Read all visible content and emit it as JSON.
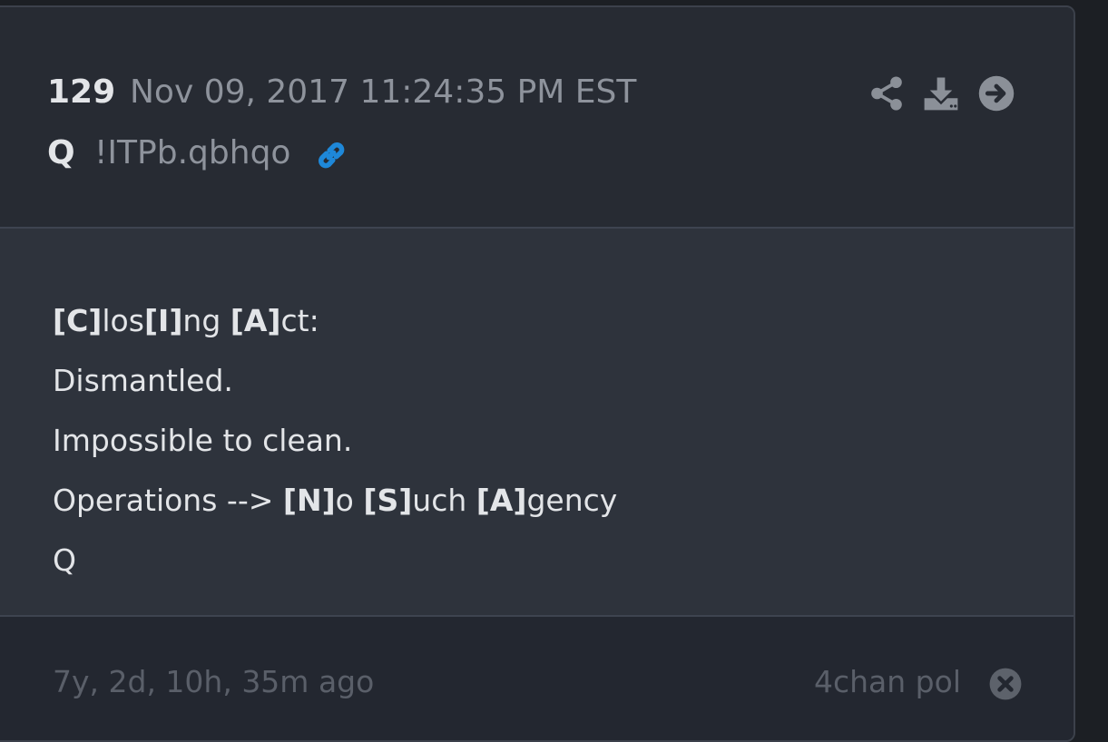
{
  "post": {
    "number": "129",
    "date": "Nov 09, 2017 11:24:35 PM EST",
    "author": "Q",
    "tripcode": "!ITPb.qbhqo"
  },
  "content": {
    "line1": {
      "a": "[C]",
      "b": "los",
      "c": "[I]",
      "d": "ng ",
      "e": "[A]",
      "f": "ct:"
    },
    "line2": "Dismantled.",
    "line3": "Impossible to clean.",
    "line4": {
      "a": "Operations --> ",
      "b": "[N]",
      "c": "o ",
      "d": "[S]",
      "e": "uch ",
      "f": "[A]",
      "g": "gency"
    },
    "line5": "Q"
  },
  "footer": {
    "ago": "7y, 2d, 10h, 35m ago",
    "source": "4chan pol"
  },
  "icons": {
    "link": "link-icon",
    "share": "share-icon",
    "download": "download-icon",
    "open": "arrow-right-circle-icon",
    "close": "close-circle-icon"
  },
  "colors": {
    "background": "#1c1f24",
    "card": "#272b33",
    "body": "#2e333c",
    "text": "#e3e5e8",
    "muted": "#8e939c",
    "link": "#1e88d9"
  }
}
